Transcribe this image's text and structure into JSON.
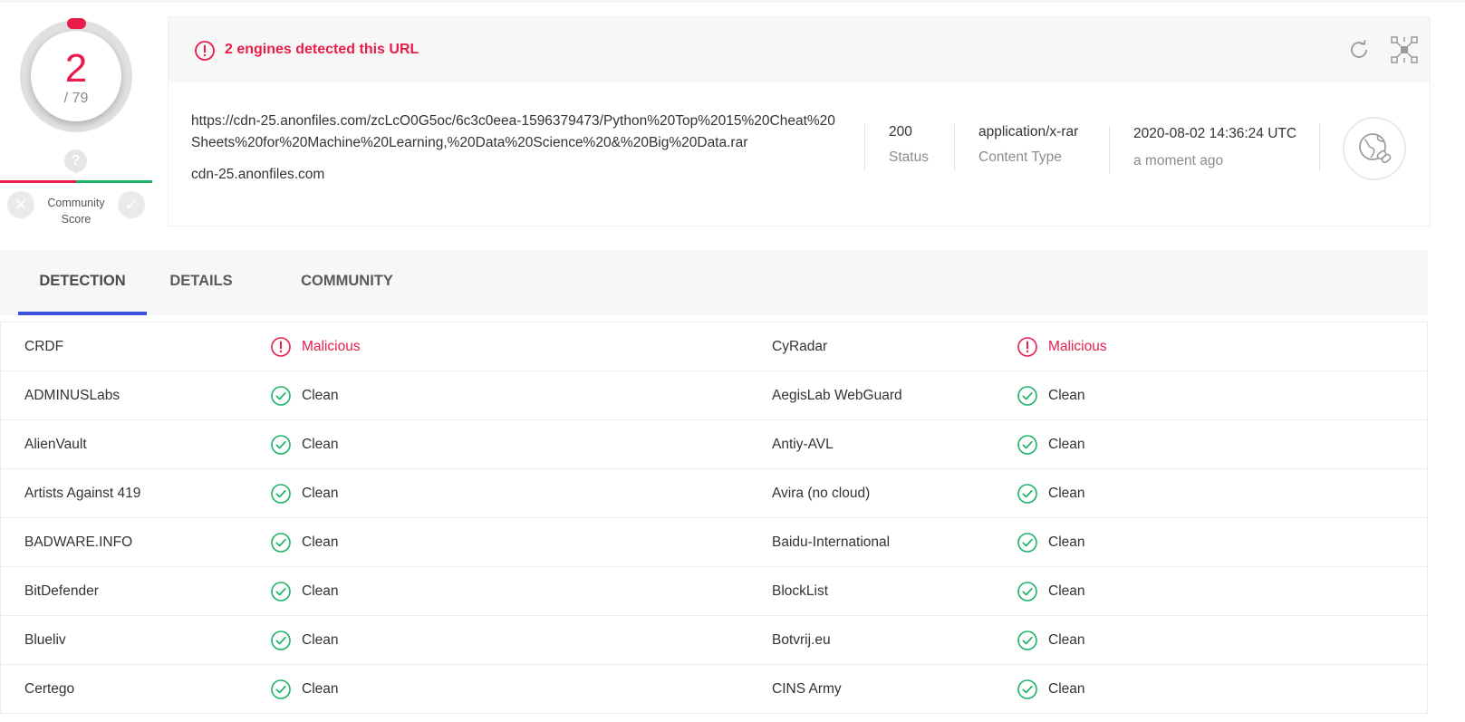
{
  "score": {
    "detected": "2",
    "total": "/ 79"
  },
  "community": {
    "help_mark": "?",
    "label_line1": "Community",
    "label_line2": "Score",
    "down_glyph": "✕",
    "up_glyph": "✓"
  },
  "summary": {
    "alert": "2 engines detected this URL",
    "url": "https://cdn-25.anonfiles.com/zcLcO0G5oc/6c3c0eea-1596379473/Python%20Top%2015%20Cheat%20Sheets%20for%20Machine%20Learning,%20Data%20Science%20&%20Big%20Data.rar",
    "domain": "cdn-25.anonfiles.com",
    "status_value": "200",
    "status_label": "Status",
    "content_type_value": "application/x-rar",
    "content_type_label": "Content Type",
    "date_value": "2020-08-02 14:36:24 UTC",
    "date_relative": "a moment ago"
  },
  "tabs": [
    {
      "label": "DETECTION",
      "active": true
    },
    {
      "label": "DETAILS",
      "active": false
    },
    {
      "label": "COMMUNITY",
      "active": false
    }
  ],
  "detections": [
    [
      {
        "engine": "CRDF",
        "result": "Malicious"
      },
      {
        "engine": "CyRadar",
        "result": "Malicious"
      }
    ],
    [
      {
        "engine": "ADMINUSLabs",
        "result": "Clean"
      },
      {
        "engine": "AegisLab WebGuard",
        "result": "Clean"
      }
    ],
    [
      {
        "engine": "AlienVault",
        "result": "Clean"
      },
      {
        "engine": "Antiy-AVL",
        "result": "Clean"
      }
    ],
    [
      {
        "engine": "Artists Against 419",
        "result": "Clean"
      },
      {
        "engine": "Avira (no cloud)",
        "result": "Clean"
      }
    ],
    [
      {
        "engine": "BADWARE.INFO",
        "result": "Clean"
      },
      {
        "engine": "Baidu-International",
        "result": "Clean"
      }
    ],
    [
      {
        "engine": "BitDefender",
        "result": "Clean"
      },
      {
        "engine": "BlockList",
        "result": "Clean"
      }
    ],
    [
      {
        "engine": "Blueliv",
        "result": "Clean"
      },
      {
        "engine": "Botvrij.eu",
        "result": "Clean"
      }
    ],
    [
      {
        "engine": "Certego",
        "result": "Clean"
      },
      {
        "engine": "CINS Army",
        "result": "Clean"
      }
    ]
  ],
  "icons": {
    "alert": "alert-circle-icon",
    "refresh": "refresh-icon",
    "graph": "graph-overview-icon",
    "link": "globe-link-icon",
    "malicious": "alert-circle-icon",
    "clean": "check-circle-icon"
  },
  "colors": {
    "malicious": "#ea1c4b",
    "clean": "#1bb367",
    "tab_active": "#3c50e0"
  }
}
